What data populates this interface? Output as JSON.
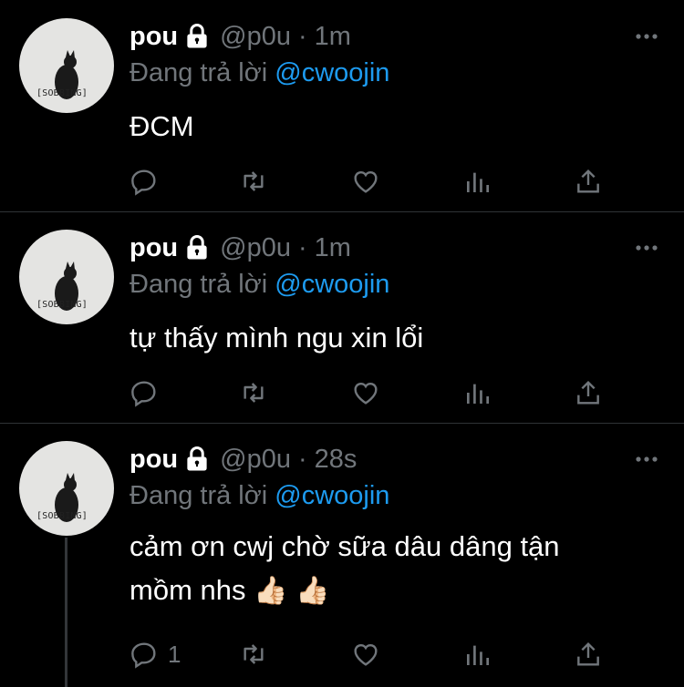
{
  "tweets": [
    {
      "author_name": "pou",
      "handle": "@p0u",
      "separator": "·",
      "time": "1m",
      "reply_prefix": "Đang trả lời",
      "reply_to": "@cwoojin",
      "avatar_caption": "[SOBBING]",
      "text_lines": [
        "ĐCM"
      ],
      "reply_count": ""
    },
    {
      "author_name": "pou",
      "handle": "@p0u",
      "separator": "·",
      "time": "1m",
      "reply_prefix": "Đang trả lời",
      "reply_to": "@cwoojin",
      "avatar_caption": "[SOBBING]",
      "text_lines": [
        "tự thấy mình ngu xin lổi"
      ],
      "reply_count": ""
    },
    {
      "author_name": "pou",
      "handle": "@p0u",
      "separator": "·",
      "time": "28s",
      "reply_prefix": "Đang trả lời",
      "reply_to": "@cwoojin",
      "avatar_caption": "[SOBBING]",
      "text_lines": [
        "cảm ơn cwj chờ sữa dâu dâng tận",
        "mồm nhs"
      ],
      "emojis": [
        "👍🏻",
        "👍🏻"
      ],
      "reply_count": "1"
    }
  ],
  "colors": {
    "background": "#000000",
    "primary_text": "#ffffff",
    "secondary_text": "#71767b",
    "mention": "#1d9bf0",
    "divider": "#2f3336"
  },
  "icons": [
    "lock-icon",
    "more-icon",
    "reply-icon",
    "retweet-icon",
    "like-icon",
    "analytics-icon",
    "share-icon"
  ]
}
